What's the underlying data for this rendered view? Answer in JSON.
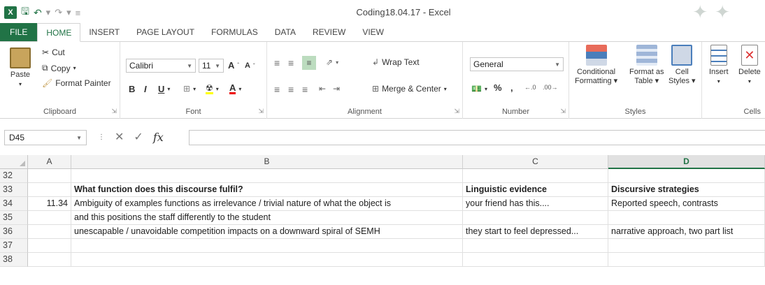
{
  "window": {
    "title": "Coding18.04.17 - Excel",
    "app_badge": "X",
    "save_icon": "save-icon",
    "undo_icon": "undo-icon",
    "redo_icon": "redo-icon",
    "accent": "#217346"
  },
  "tabs": [
    "FILE",
    "HOME",
    "INSERT",
    "PAGE LAYOUT",
    "FORMULAS",
    "DATA",
    "REVIEW",
    "VIEW"
  ],
  "active_tab": "HOME",
  "ribbon": {
    "clipboard": {
      "paste": "Paste",
      "cut": "Cut",
      "copy": "Copy",
      "format_painter": "Format Painter",
      "label": "Clipboard"
    },
    "font": {
      "name": "Calibri",
      "size": "11",
      "grow": "A",
      "shrink": "A",
      "bold": "B",
      "italic": "I",
      "underline": "U",
      "font_color": "A",
      "label": "Font"
    },
    "alignment": {
      "wrap_text": "Wrap Text",
      "merge_center": "Merge & Center",
      "label": "Alignment"
    },
    "number": {
      "format": "General",
      "percent": "%",
      "comma": ",",
      "label": "Number"
    },
    "styles": {
      "conditional": "Conditional",
      "conditional2": "Formatting",
      "format_as": "Format as",
      "format_as2": "Table",
      "cell": "Cell",
      "cell2": "Styles",
      "label": "Styles"
    },
    "cells": {
      "insert": "Insert",
      "delete": "Delete",
      "label": "Cells"
    }
  },
  "formula_bar": {
    "name_box": "D45",
    "fx": "fx",
    "formula": ""
  },
  "sheet": {
    "columns": [
      "A",
      "B",
      "C",
      "D"
    ],
    "selected_column": "D",
    "rows": [
      {
        "n": "32",
        "A": "",
        "B": "",
        "C": "",
        "D": ""
      },
      {
        "n": "33",
        "A": "",
        "B": "What function does this discourse fulfil?",
        "C": "Linguistic evidence",
        "D": "Discursive strategies"
      },
      {
        "n": "34",
        "A": "11.34",
        "B": "Ambiguity of examples functions as irrelevance / trivial nature of what the object is",
        "C": "your friend has this....",
        "D": "Reported speech, contrasts"
      },
      {
        "n": "35",
        "A": "",
        "B": "and this positions the staff differently to the student",
        "C": "",
        "D": ""
      },
      {
        "n": "36",
        "A": "",
        "B": "unescapable / unavoidable competition impacts on a downward spiral of SEMH",
        "C": "they start to feel depressed...",
        "D": "narrative approach, two part list"
      },
      {
        "n": "37",
        "A": "",
        "B": "",
        "C": "",
        "D": ""
      },
      {
        "n": "38",
        "A": "",
        "B": "",
        "C": "",
        "D": ""
      }
    ]
  }
}
